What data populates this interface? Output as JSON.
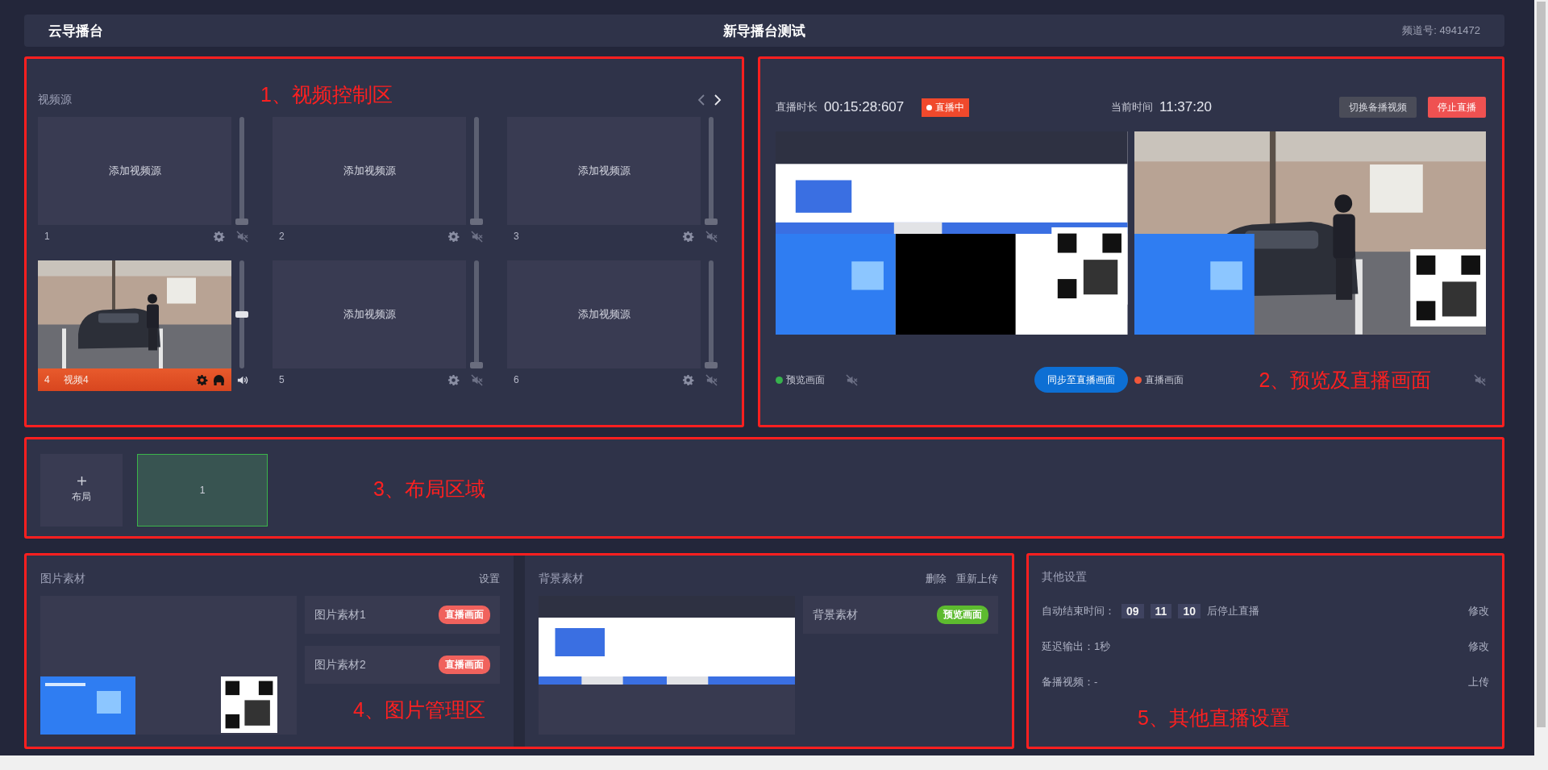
{
  "header": {
    "logo": "云导播台",
    "title": "新导播台测试",
    "channel": "频道号: 4941472"
  },
  "video_control": {
    "annotation": "1、视频控制区",
    "title": "视频源",
    "sources": [
      {
        "kind": "empty",
        "number": "1",
        "placeholder": "添加视频源",
        "selected": false,
        "muted": true,
        "monitoring": false,
        "level": 0
      },
      {
        "kind": "empty",
        "number": "2",
        "placeholder": "添加视频源",
        "selected": false,
        "muted": true,
        "monitoring": false,
        "level": 0
      },
      {
        "kind": "empty",
        "number": "3",
        "placeholder": "添加视频源",
        "selected": false,
        "muted": true,
        "monitoring": false,
        "level": 0
      },
      {
        "kind": "camera",
        "number": "4",
        "name": "视频4",
        "selected": true,
        "muted": false,
        "monitoring": true,
        "level": 0.5
      },
      {
        "kind": "empty",
        "number": "5",
        "placeholder": "添加视频源",
        "selected": false,
        "muted": true,
        "monitoring": false,
        "level": 0
      },
      {
        "kind": "empty",
        "number": "6",
        "placeholder": "添加视频源",
        "selected": false,
        "muted": true,
        "monitoring": false,
        "level": 0
      }
    ]
  },
  "preview": {
    "annotation": "2、预览及直播画面",
    "duration_label": "直播时长",
    "duration": "00:15:28:607",
    "live_badge": "直播中",
    "time_label": "当前时间",
    "time": "11:37:20",
    "buttons": [
      {
        "label": "切换备播视频",
        "kind": "secondary"
      },
      {
        "label": "停止直播",
        "kind": "danger"
      }
    ],
    "preview_label": "预览画面",
    "preview_muted": true,
    "sync_button": "同步至直播画面",
    "live_label": "直播画面",
    "live_muted": true
  },
  "layouts": {
    "annotation": "3、布局区域",
    "add_label": "布局",
    "items": [
      {
        "label": "1",
        "selected": true
      }
    ]
  },
  "images": {
    "annotation": "4、图片管理区",
    "title": "图片素材",
    "action": "设置",
    "items": [
      {
        "name": "图片素材1",
        "tag": "直播画面",
        "kind": "live"
      },
      {
        "name": "图片素材2",
        "tag": "直播画面",
        "kind": "live"
      }
    ]
  },
  "background": {
    "title": "背景素材",
    "actions": [
      "删除",
      "重新上传"
    ],
    "items": [
      {
        "name": "背景素材",
        "tag": "预览画面",
        "kind": "preview"
      }
    ]
  },
  "other_settings": {
    "annotation": "5、其他直播设置",
    "title": "其他设置",
    "rows": [
      {
        "kind": "timer",
        "label": "自动结束时间：",
        "digits": [
          "09",
          "11",
          "10"
        ],
        "suffix": "后停止直播",
        "action": "修改"
      },
      {
        "kind": "text",
        "label": "延迟输出：1秒",
        "action": "修改"
      },
      {
        "kind": "text",
        "label": "备播视频：-",
        "action": "上传"
      }
    ]
  }
}
